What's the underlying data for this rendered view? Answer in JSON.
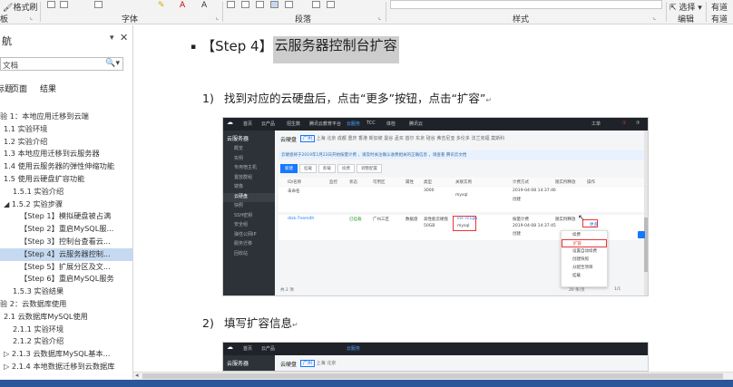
{
  "ribbon": {
    "format_painter": "格式刷",
    "clipboard_label": "板",
    "font_group": "字体",
    "paragraph_group": "段落",
    "styles_group": "样式",
    "select_label": "选择",
    "editing_group": "编辑",
    "right_group_1": "有道",
    "right_group_2": "有道"
  },
  "nav": {
    "title": "航",
    "dropdown_glyph": "▾",
    "close_glyph": "✕",
    "search_placeholder": "文档",
    "search_icon_glyph": "🔍",
    "tabs": [
      "标题",
      "页面",
      "结果"
    ],
    "items": [
      {
        "text": "验 1：本地应用迁移到云端"
      },
      {
        "text": "1.1 实验环境"
      },
      {
        "text": "1.2 实验介绍"
      },
      {
        "text": "1.3 本地应用迁移到云服务器"
      },
      {
        "text": "1.4 使用云服务器的弹性伸缩功能"
      },
      {
        "text": "1.5 使用云硬盘扩容功能"
      },
      {
        "text": "1.5.1 实验介绍"
      },
      {
        "text": "◢ 1.5.2 实验步骤"
      },
      {
        "text": "【Step 1】模拟硬盘被占满"
      },
      {
        "text": "【Step 2】重启MySQL服..."
      },
      {
        "text": "【Step 3】控制台查看云..."
      },
      {
        "text": "【Step 4】云服务器控制..."
      },
      {
        "text": "【Step 5】扩展分区及文..."
      },
      {
        "text": "【Step 6】重启MySQL服务"
      },
      {
        "text": "1.5.3 实验结果"
      },
      {
        "text": "验 2：云数据库使用"
      },
      {
        "text": "2.1 云数据库MySQL使用"
      },
      {
        "text": "2.1.1 实验环境"
      },
      {
        "text": "2.1.2 实验介绍"
      },
      {
        "text": "▷ 2.1.3 云数据库MySQL基本..."
      },
      {
        "text": "▷ 2.1.4 本地数据迁移到云数据库"
      }
    ]
  },
  "doc": {
    "heading_bullet": "▪",
    "heading_prefix": "【Step 4】",
    "heading_highlight": "云服务器控制台扩容",
    "para_mark": "↵",
    "step1_num": "1)",
    "step1_text": "找到对应的云硬盘后，点击“更多”按钮，点击“扩容”",
    "step2_num": "2)",
    "step2_text": "填写扩容信息"
  },
  "console": {
    "topbar": [
      "首页",
      "云产品",
      "招生数",
      "腾讯云教育平台",
      "云服务",
      "TCC",
      "体检",
      "腾讯云",
      "工单",
      "①",
      "⑦"
    ],
    "sidebar_header": "云服务器",
    "sidebar_items": [
      "概览",
      "实例",
      "专用宿主机",
      "置放群组",
      "镜像",
      "云硬盘",
      "快照",
      "SSH密钥",
      "安全组",
      "弹性公网IP",
      "服务迁移",
      "回收站"
    ],
    "page_title": "云硬盘",
    "regions": [
      "广州",
      "上海",
      "北京",
      "成都",
      "重庆",
      "香港",
      "新加坡",
      "曼谷",
      "孟买",
      "首尔",
      "东京",
      "硅谷",
      "弗吉尼亚",
      "多伦多",
      "法兰克福",
      "莫斯科"
    ],
    "notice": "云硬盘将于2019年1月23日开始按量计费 ，请及时关注确认收费相关的正确信息 ，请查看 腾讯云文档",
    "buttons": [
      "新建",
      "挂载",
      "卸载",
      "续费",
      "调整配置"
    ],
    "headers": [
      "ID/名称",
      "监控",
      "状态",
      "可用区",
      "属性",
      "类型",
      "关联实例",
      "计费方式",
      "随实例释放",
      "操作"
    ],
    "row1": {
      "name": "未命名",
      "type": "3000",
      "instance": "mysql",
      "date": "2019-04-08 14:37:46",
      "state": "创建"
    },
    "row2": {
      "id": "disk-7nem4h",
      "status": "已挂载",
      "zone": "广州三区",
      "attr": "数据盘",
      "type": "高性能云硬盘",
      "size": "50GB",
      "instance": "ins-7c1gu",
      "instance_name": "mysql",
      "billing": "按量计费",
      "date": "2019-04-08 14:37:45",
      "state": "创建",
      "release": "随实例释放",
      "action": "更多"
    },
    "menu_items": [
      "续费",
      "扩容",
      "设置自动续费",
      "创建快照",
      "分配至项目",
      "挂载",
      "卸载",
      "修改属性",
      "编辑标签"
    ],
    "pagination": {
      "total": "共 2 项",
      "per_page": "20 条/页",
      "page": "1/1"
    }
  }
}
